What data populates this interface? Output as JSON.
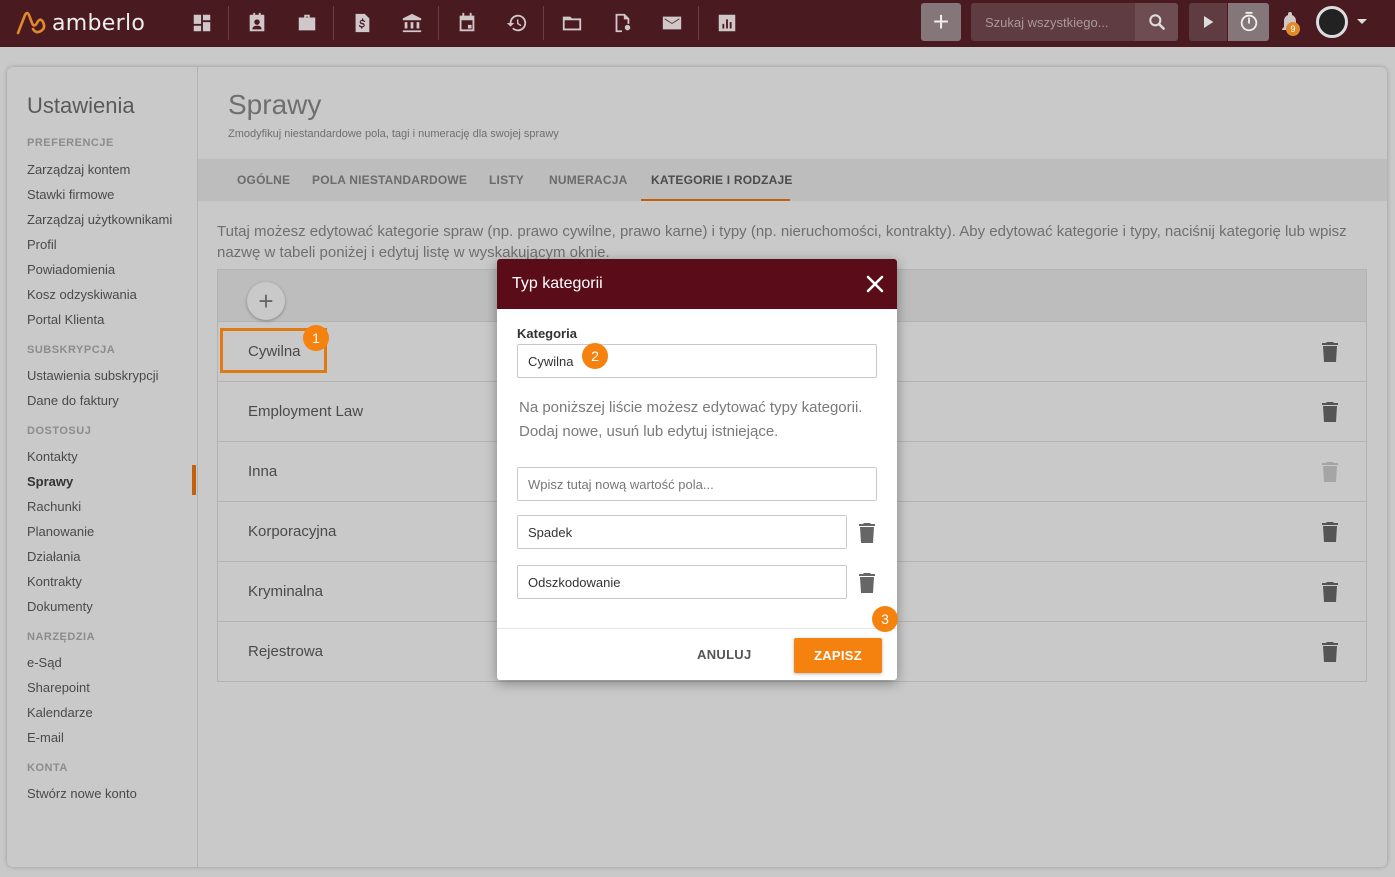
{
  "app": {
    "name": "amberlo"
  },
  "topbar": {
    "icons": [
      "dashboard-icon",
      "contacts-icon",
      "briefcase-icon",
      "invoice-icon",
      "bank-icon",
      "calendar-icon",
      "history-icon",
      "folder-icon",
      "document-settings-icon",
      "mail-icon",
      "reports-icon"
    ],
    "add_label": "+",
    "search_placeholder": "Szukaj wszystkiego...",
    "notification_count": "9"
  },
  "sidebar": {
    "title": "Ustawienia",
    "sections": [
      {
        "label": "PREFERENCJE",
        "items": [
          "Zarządzaj kontem",
          "Stawki firmowe",
          "Zarządzaj użytkownikami",
          "Profil",
          "Powiadomienia",
          "Kosz odzyskiwania",
          "Portal Klienta"
        ]
      },
      {
        "label": "SUBSKRYPCJA",
        "items": [
          "Ustawienia subskrypcji",
          "Dane do faktury"
        ]
      },
      {
        "label": "DOSTOSUJ",
        "items": [
          "Kontakty",
          "Sprawy",
          "Rachunki",
          "Planowanie",
          "Działania",
          "Kontrakty",
          "Dokumenty"
        ]
      },
      {
        "label": "NARZĘDZIA",
        "items": [
          "e-Sąd",
          "Sharepoint",
          "Kalendarze",
          "E-mail"
        ]
      },
      {
        "label": "KONTA",
        "items": [
          "Stwórz nowe konto"
        ]
      }
    ],
    "active_item": "Sprawy"
  },
  "page": {
    "title": "Sprawy",
    "subtitle": "Zmodyfikuj niestandardowe pola, tagi i numerację dla swojej sprawy",
    "tabs": [
      "OGÓLNE",
      "POLA NIESTANDARDOWE",
      "LISTY",
      "NUMERACJA",
      "KATEGORIE I RODZAJE"
    ],
    "active_tab": "KATEGORIE I RODZAJE",
    "description": "Tutaj możesz edytować kategorie spraw (np. prawo cywilne, prawo karne) i typy (np. nieruchomości, kontrakty). Aby edytować kategorie i typy, naciśnij kategorię lub wpisz nazwę w tabeli poniżej i edytuj listę w wyskakującym oknie."
  },
  "table": {
    "add_label": "+",
    "rows": [
      "Cywilna",
      "Employment Law",
      "Inna",
      "Korporacyjna",
      "Kryminalna",
      "Rejestrowa"
    ]
  },
  "modal": {
    "title": "Typ kategorii",
    "field_label": "Kategoria",
    "field_value": "Cywilna",
    "hint": "Na poniższej liście możesz edytować typy kategorii. Dodaj nowe, usuń lub edytuj istniejące.",
    "new_value_placeholder": "Wpisz tutaj nową wartość pola...",
    "types": [
      "Spadek",
      "Odszkodowanie"
    ],
    "cancel_label": "ANULUJ",
    "save_label": "ZAPISZ"
  },
  "annotations": [
    "1",
    "2",
    "3"
  ],
  "colors": {
    "topbar": "#4a1a21",
    "modal_header": "#5a0d19",
    "accent": "#f5820f"
  }
}
